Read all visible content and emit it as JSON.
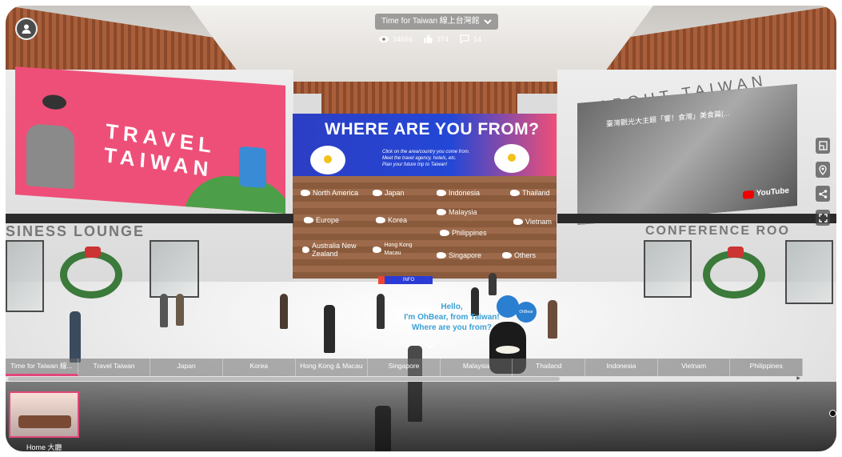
{
  "header": {
    "title": "Time for Taiwan 線上台灣館",
    "views": "34666",
    "likes": "374",
    "comments": "14"
  },
  "scene": {
    "travel_board": {
      "title_line1": "TRAVEL",
      "title_line2": "TAIWAN"
    },
    "where_board": {
      "title": "WHERE ARE YOU FROM?",
      "subtitle_line1": "Click on the area/country you come from.",
      "subtitle_line2": "Meet the travel agency, hotels, etc.",
      "subtitle_line3": "Plan your future trip to Taiwan!"
    },
    "regions": [
      {
        "label": "North America"
      },
      {
        "label": "Japan"
      },
      {
        "label": "Indonesia"
      },
      {
        "label": "Thailand"
      },
      {
        "label": "Europe"
      },
      {
        "label": "Korea"
      },
      {
        "label": "Malaysia"
      },
      {
        "label": "Vietnam"
      },
      {
        "label": "Philippines"
      },
      {
        "label": "Australia New Zealand"
      },
      {
        "label": "Hong Kong Macau"
      },
      {
        "label": "Singapore"
      },
      {
        "label": "Others"
      }
    ],
    "info_label": "INFO",
    "about_title": "ABOUT TAIWAN",
    "video": {
      "title": "臺灣觀光大主題「饗！食灣」美食篇(...",
      "brand": "YouTube"
    },
    "business_lounge": "SINESS LOUNGE",
    "conference_room": "CONFERENCE ROO",
    "speech": {
      "line1": "Hello,",
      "line2": "I'm OhBear, from Taiwan!",
      "line3": "Where are you from?"
    },
    "balloon_text": "OhBear"
  },
  "tabs": [
    {
      "label": "Time for Taiwan 線...",
      "active": true
    },
    {
      "label": "Travel Taiwan",
      "active": false
    },
    {
      "label": "Japan",
      "active": false
    },
    {
      "label": "Korea",
      "active": false
    },
    {
      "label": "Hong Kong & Macau",
      "active": false
    },
    {
      "label": "Singapore",
      "active": false
    },
    {
      "label": "Malaysia",
      "active": false
    },
    {
      "label": "Thailand",
      "active": false
    },
    {
      "label": "Indonesia",
      "active": false
    },
    {
      "label": "Vietnam",
      "active": false
    },
    {
      "label": "Philippines",
      "active": false
    }
  ],
  "thumbnails": [
    {
      "label": "Home 大廳",
      "selected": true
    }
  ],
  "colors": {
    "accent": "#e0477a",
    "where_blue": "#2347d6",
    "travel_pink": "#ee4f78"
  },
  "icons": {
    "avatar": "user-icon",
    "views": "eye-icon",
    "likes": "thumbs-up-icon",
    "comments": "comment-icon",
    "dropdown": "chevron-down-icon",
    "tools": [
      "floorplan-icon",
      "location-pin-icon",
      "share-icon",
      "fullscreen-icon"
    ]
  }
}
